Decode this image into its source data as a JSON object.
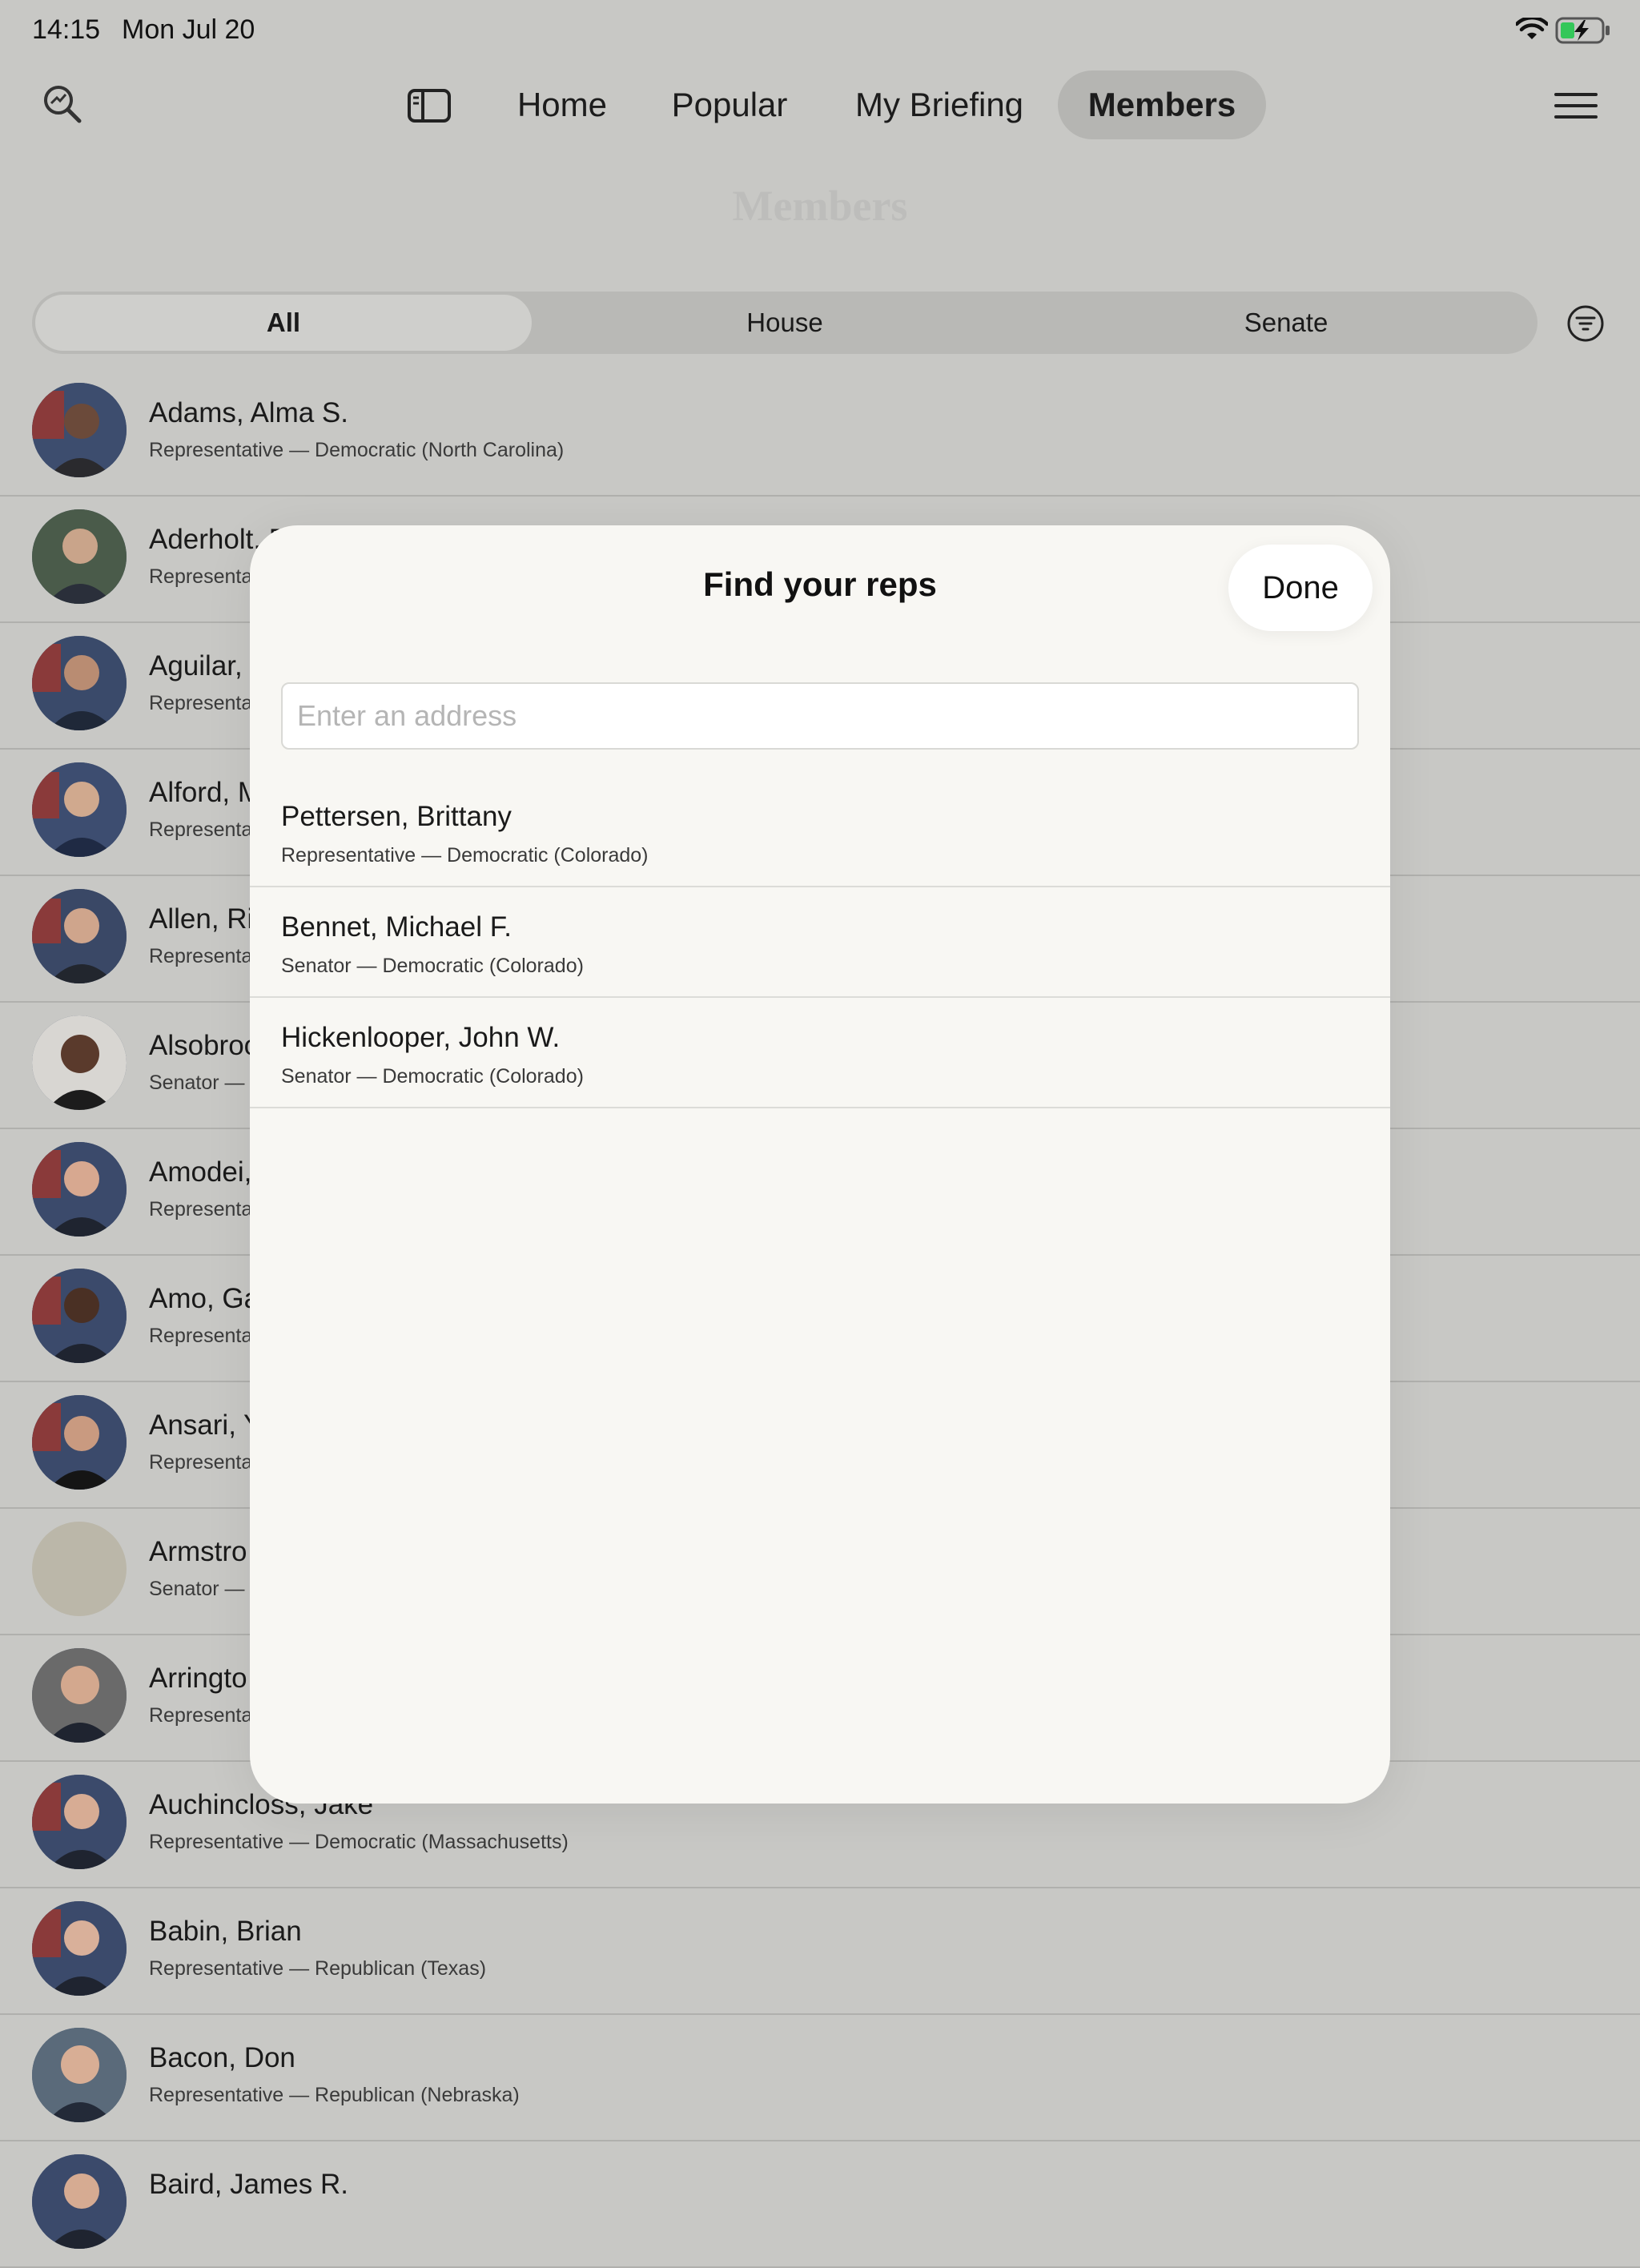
{
  "status": {
    "time": "14:15",
    "date": "Mon Jul 20"
  },
  "nav": {
    "tabs": [
      {
        "label": "Home"
      },
      {
        "label": "Popular"
      },
      {
        "label": "My Briefing"
      },
      {
        "label": "Members"
      }
    ],
    "active_tab": "Members"
  },
  "page": {
    "title": "Members"
  },
  "segments": {
    "all": "All",
    "house": "House",
    "senate": "Senate",
    "selected": "All"
  },
  "members": [
    {
      "name": "Adams, Alma S.",
      "subtitle": "Representative — Democratic (North Carolina)"
    },
    {
      "name": "Aderholt, R",
      "subtitle": "Representa"
    },
    {
      "name": "Aguilar,",
      "subtitle": "Representa"
    },
    {
      "name": "Alford, M",
      "subtitle": "Representa"
    },
    {
      "name": "Allen, Ri",
      "subtitle": "Representa"
    },
    {
      "name": "Alsobroo",
      "subtitle": "Senator —"
    },
    {
      "name": "Amodei,",
      "subtitle": "Representa"
    },
    {
      "name": "Amo, Ga",
      "subtitle": "Representa"
    },
    {
      "name": "Ansari, Y",
      "subtitle": "Representa"
    },
    {
      "name": "Armstro",
      "subtitle": "Senator —"
    },
    {
      "name": "Arringto",
      "subtitle": "Representa"
    },
    {
      "name": "Auchincloss, Jake",
      "subtitle": "Representative — Democratic (Massachusetts)"
    },
    {
      "name": "Babin, Brian",
      "subtitle": "Representative — Republican (Texas)"
    },
    {
      "name": "Bacon, Don",
      "subtitle": "Representative — Republican (Nebraska)"
    },
    {
      "name": "Baird, James R.",
      "subtitle": ""
    }
  ],
  "modal": {
    "title": "Find your reps",
    "done_label": "Done",
    "address_placeholder": "Enter an address",
    "address_value": "",
    "reps": [
      {
        "name": "Pettersen, Brittany",
        "subtitle": "Representative — Democratic (Colorado)"
      },
      {
        "name": "Bennet, Michael F.",
        "subtitle": "Senator — Democratic (Colorado)"
      },
      {
        "name": "Hickenlooper, John W.",
        "subtitle": "Senator — Democratic (Colorado)"
      }
    ]
  },
  "colors": {
    "overlay_bg": "#c8c8c5",
    "modal_bg": "#f8f7f3",
    "active_tab_bg": "#b5b5b2"
  }
}
